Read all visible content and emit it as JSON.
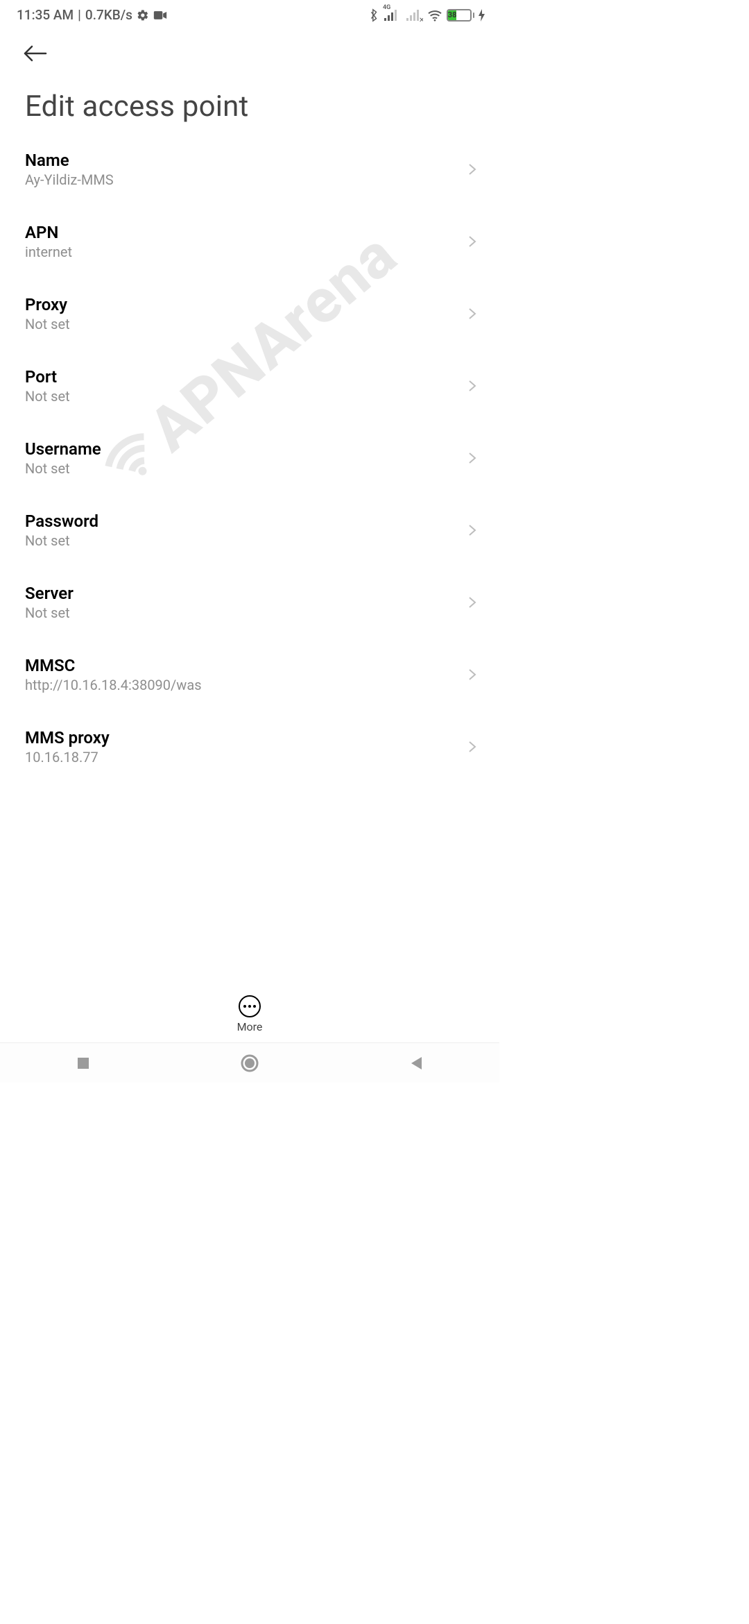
{
  "status": {
    "time": "11:35 AM",
    "sep": "|",
    "net_speed": "0.7KB/s",
    "sig_label": "4G",
    "battery_pct": "38"
  },
  "page": {
    "title": "Edit access point"
  },
  "settings": [
    {
      "label": "Name",
      "value": "Ay-Yildiz-MMS"
    },
    {
      "label": "APN",
      "value": "internet"
    },
    {
      "label": "Proxy",
      "value": "Not set"
    },
    {
      "label": "Port",
      "value": "Not set"
    },
    {
      "label": "Username",
      "value": "Not set"
    },
    {
      "label": "Password",
      "value": "Not set"
    },
    {
      "label": "Server",
      "value": "Not set"
    },
    {
      "label": "MMSC",
      "value": "http://10.16.18.4:38090/was"
    },
    {
      "label": "MMS proxy",
      "value": "10.16.18.77"
    }
  ],
  "bottom": {
    "more_label": "More"
  },
  "watermark": "APNArena"
}
